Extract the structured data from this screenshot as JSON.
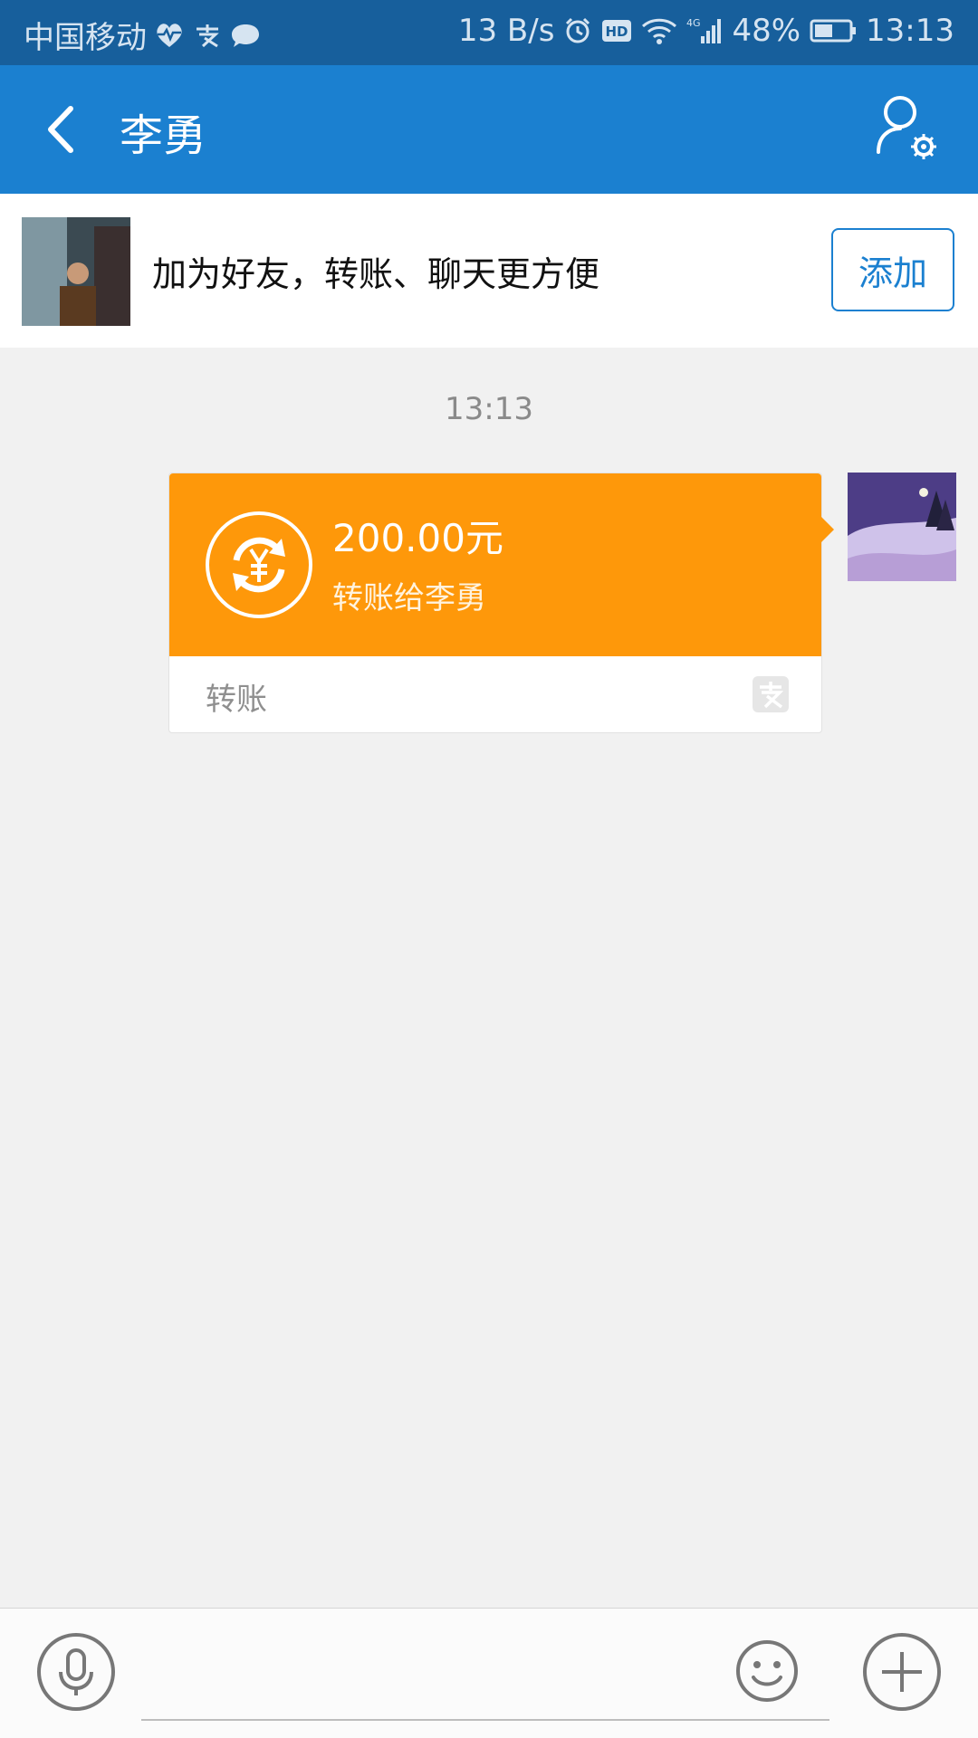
{
  "status_bar": {
    "carrier": "中国移动",
    "net_speed": "13 B/s",
    "battery": "48%",
    "time": "13:13",
    "icons": [
      "heart-rate-icon",
      "alipay-icon",
      "message-icon",
      "alarm-icon",
      "hd-icon",
      "wifi-icon",
      "4g-signal-icon",
      "battery-icon"
    ]
  },
  "header": {
    "title": "李勇",
    "back_icon": "back-arrow-icon",
    "settings_icon": "user-settings-icon"
  },
  "banner": {
    "message": "加为好友，转账、聊天更方便",
    "add_label": "添加"
  },
  "chat": {
    "timestamp": "13:13",
    "transfer": {
      "amount": "200.00元",
      "description": "转账给李勇",
      "type_label": "转账",
      "icon": "yuan-transfer-icon",
      "brand_icon": "alipay-icon"
    }
  },
  "input_bar": {
    "voice_icon": "microphone-icon",
    "emoji_icon": "emoji-icon",
    "plus_icon": "plus-icon",
    "placeholder": ""
  },
  "colors": {
    "status_bar": "#175f9c",
    "title_bar": "#1b80d0",
    "transfer_orange": "#fe980a",
    "background": "#f1f1f1"
  }
}
